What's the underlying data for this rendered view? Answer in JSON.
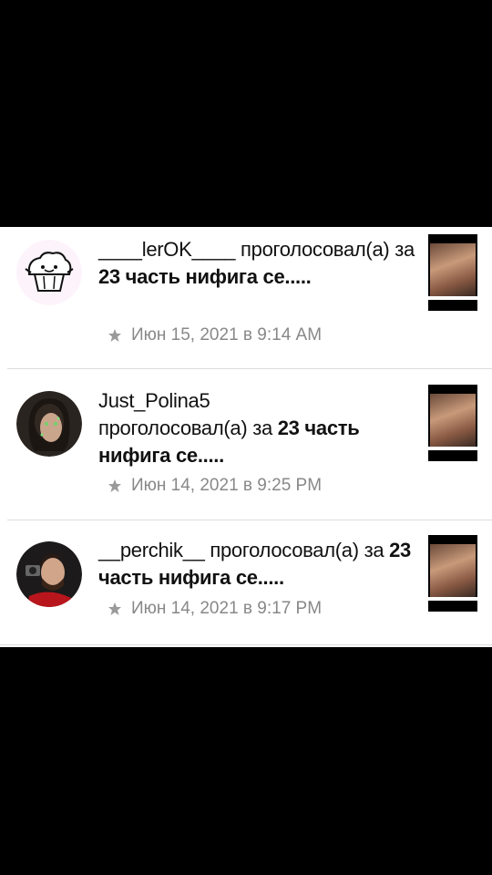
{
  "feed": {
    "items": [
      {
        "username": "____lerOK____",
        "action_prefix": " проголосовал(а) за ",
        "post_title": "23 часть нифига се.....",
        "time": "Июн 15, 2021 в 9:14 AM"
      },
      {
        "username": "Just_Polina5",
        "action_prefix": " проголосовал(а) за ",
        "post_title": "23 часть нифига се.....",
        "time": "Июн 14, 2021 в 9:25 PM"
      },
      {
        "username": "__perchik__",
        "action_prefix": " проголосовал(а) за ",
        "post_title": "23 часть нифига се.....",
        "time": "Июн 14, 2021 в 9:17 PM"
      }
    ]
  },
  "icons": {
    "time": "star-icon"
  },
  "colors": {
    "background": "#ffffff",
    "text": "#111111",
    "timestamp": "#888888",
    "divider": "#dcdcdc"
  }
}
